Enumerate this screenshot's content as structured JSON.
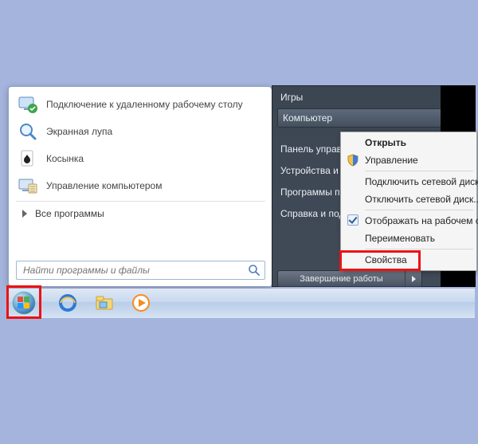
{
  "colors": {
    "highlight": "#e11",
    "taskbar": "#cfe0f2"
  },
  "start_menu": {
    "items": [
      {
        "label": "Подключение к удаленному рабочему столу",
        "icon": "remote-desktop-icon"
      },
      {
        "label": "Экранная лупа",
        "icon": "magnifier-icon"
      },
      {
        "label": "Косынка",
        "icon": "solitaire-icon"
      },
      {
        "label": "Управление компьютером",
        "icon": "computer-mgmt-icon"
      }
    ],
    "all_programs": "Все программы",
    "search_placeholder": "Найти программы и файлы"
  },
  "right_panel": {
    "items": [
      "Игры",
      "Компьютер",
      "Панель управления",
      "Устройства и принтеры",
      "Программы по умолчанию",
      "Справка и поддержка"
    ],
    "highlighted_index": 1,
    "shutdown_label": "Завершение работы"
  },
  "context_menu": {
    "items": [
      {
        "label": "Открыть",
        "bold": true
      },
      {
        "label": "Управление",
        "icon": "shield-icon"
      },
      {
        "sep": true
      },
      {
        "label": "Подключить сетевой диск..."
      },
      {
        "label": "Отключить сетевой диск..."
      },
      {
        "sep": true
      },
      {
        "label": "Отображать на рабочем столе",
        "checked": true
      },
      {
        "label": "Переименовать"
      },
      {
        "sep": true
      },
      {
        "label": "Свойства"
      }
    ],
    "highlighted_label": "Свойства"
  },
  "taskbar": {
    "icons": [
      "start-orb",
      "ie-icon",
      "explorer-icon",
      "media-player-icon"
    ]
  }
}
